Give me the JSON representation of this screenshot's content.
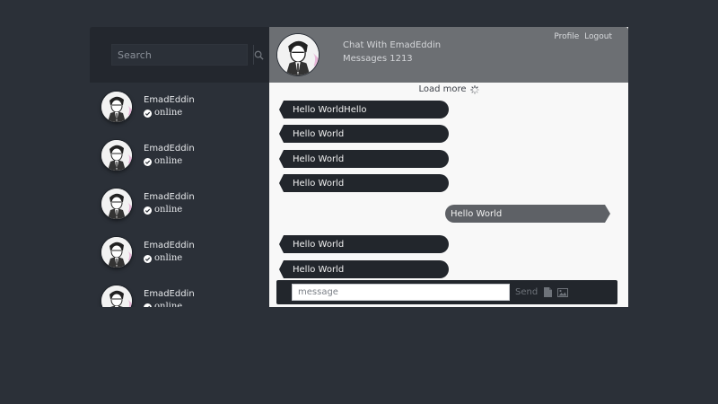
{
  "sidebar": {
    "search_placeholder": "Search",
    "contacts": [
      {
        "name": "EmadEddin",
        "status": "online"
      },
      {
        "name": "EmadEddin",
        "status": "online"
      },
      {
        "name": "EmadEddin",
        "status": "online"
      },
      {
        "name": "EmadEddin",
        "status": "online"
      },
      {
        "name": "EmadEddin",
        "status": "online"
      }
    ]
  },
  "header": {
    "title": "Chat With EmadEddin",
    "messages_count": "Messages 1213",
    "profile_link": "Profile",
    "logout_link": "Logout"
  },
  "chat": {
    "load_more": "Load more",
    "messages": [
      {
        "text": "Hello WorldHello",
        "direction": "in"
      },
      {
        "text": "Hello World",
        "direction": "in"
      },
      {
        "text": "Hello World",
        "direction": "in"
      },
      {
        "text": "Hello World",
        "direction": "in"
      },
      {
        "text": "Hello World",
        "direction": "out"
      },
      {
        "text": "Hello World",
        "direction": "in"
      },
      {
        "text": "Hello World",
        "direction": "in"
      }
    ]
  },
  "composer": {
    "placeholder": "message",
    "send_label": "Send"
  },
  "colors": {
    "background": "#2b3038",
    "header": "#6c6f73",
    "incoming_bubble": "#22262c",
    "outgoing_bubble": "#5e6166"
  }
}
